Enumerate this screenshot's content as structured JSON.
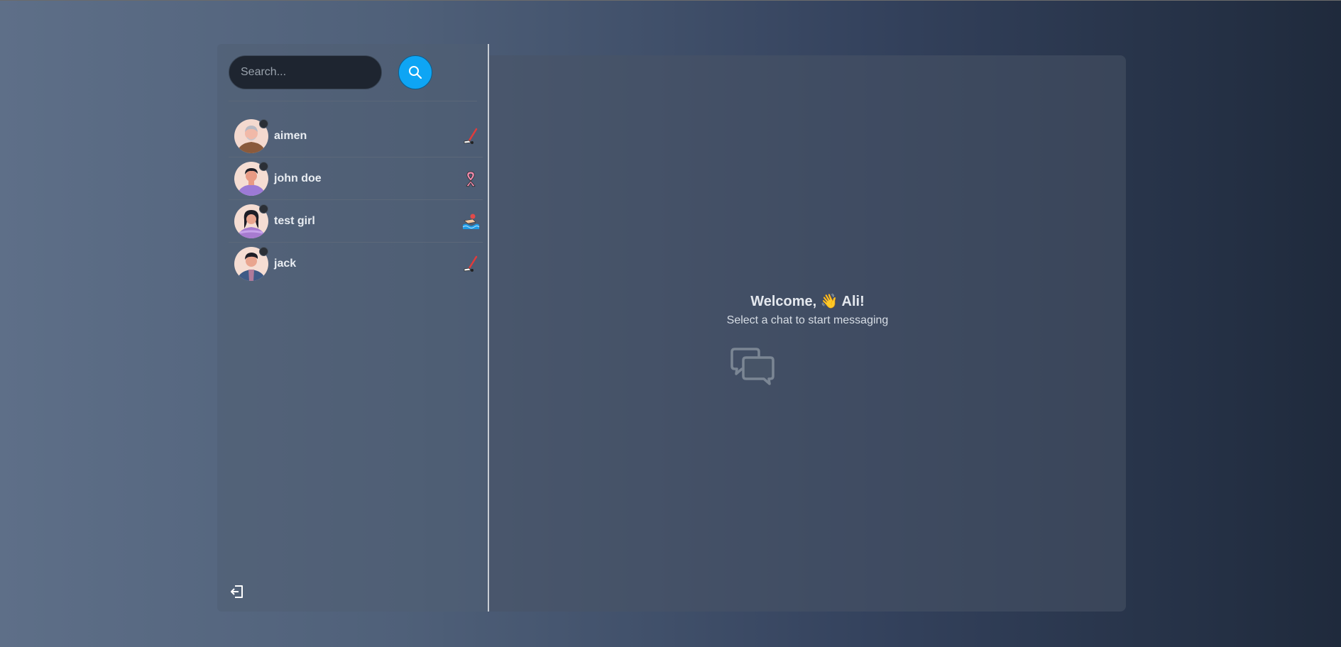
{
  "search": {
    "placeholder": "Search..."
  },
  "conversations": [
    {
      "name": "aimen",
      "emoji": "hockey-stick-icon"
    },
    {
      "name": "john doe",
      "emoji": "ribbon-icon"
    },
    {
      "name": "test girl",
      "emoji": "swimmer-icon"
    },
    {
      "name": "jack",
      "emoji": "hockey-stick-icon"
    }
  ],
  "main": {
    "welcome_prefix": "Welcome,",
    "welcome_emoji": "👋",
    "welcome_name": "Ali!",
    "subtitle": "Select a chat to start messaging"
  },
  "colors": {
    "accent": "#0ea5f4",
    "background_start": "#5e6f88",
    "background_end": "#1f2a3c"
  }
}
